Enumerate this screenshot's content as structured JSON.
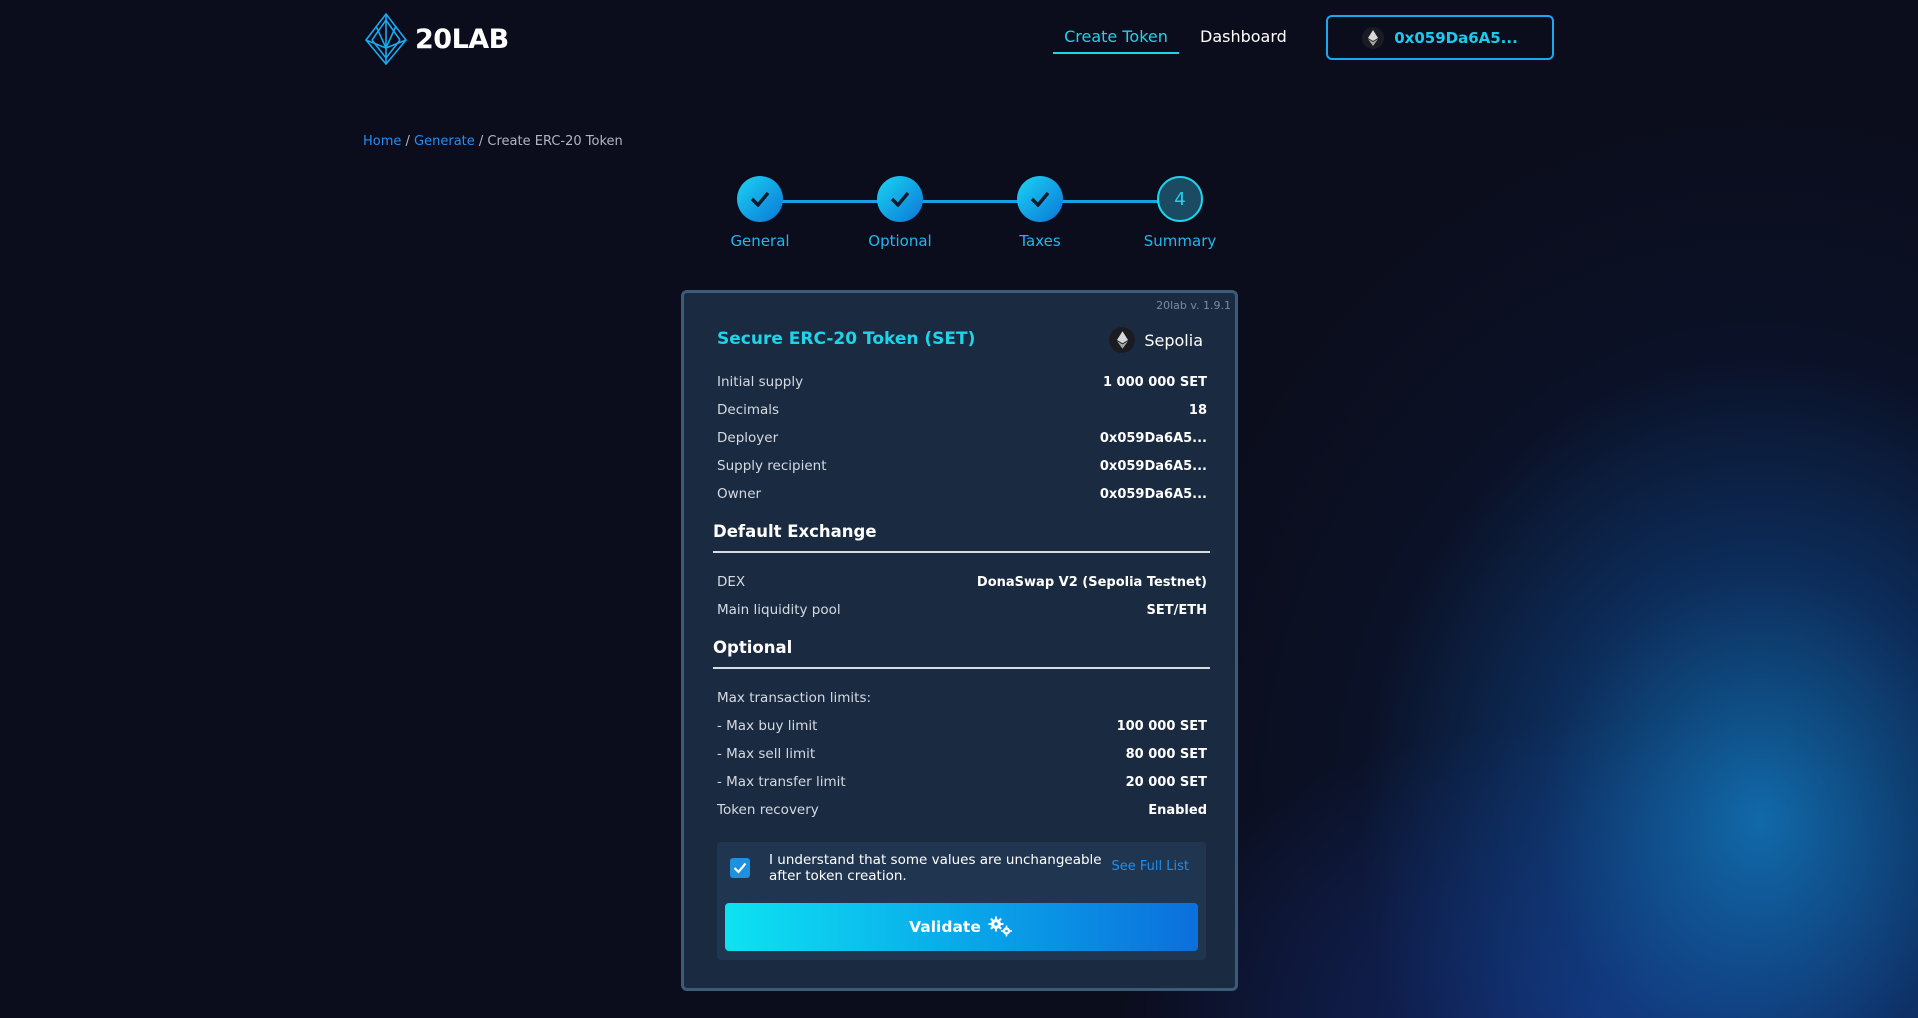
{
  "header": {
    "logo_text": "20LAB",
    "nav": {
      "create_token": "Create Token",
      "dashboard": "Dashboard"
    },
    "wallet_address": "0x059Da6A5..."
  },
  "breadcrumb": {
    "home": "Home",
    "sep1": " / ",
    "generate": "Generate",
    "sep2": " / ",
    "current": "Create ERC-20 Token"
  },
  "stepper": {
    "steps": [
      {
        "label": "General",
        "state": "done"
      },
      {
        "label": "Optional",
        "state": "done"
      },
      {
        "label": "Taxes",
        "state": "done"
      },
      {
        "label": "Summary",
        "state": "current",
        "number": "4"
      }
    ]
  },
  "summary": {
    "version": "20lab v. 1.9.1",
    "title": "Secure ERC-20 Token (SET)",
    "network": "Sepolia",
    "general_rows": [
      {
        "label": "Initial supply",
        "value": "1 000 000 SET"
      },
      {
        "label": "Decimals",
        "value": "18"
      },
      {
        "label": "Deployer",
        "value": "0x059Da6A5..."
      },
      {
        "label": "Supply recipient",
        "value": "0x059Da6A5..."
      },
      {
        "label": "Owner",
        "value": "0x059Da6A5..."
      }
    ],
    "exchange": {
      "heading": "Default Exchange",
      "rows": [
        {
          "label": "DEX",
          "value": "DonaSwap V2 (Sepolia Testnet)"
        },
        {
          "label": "Main liquidity pool",
          "value": "SET/ETH"
        }
      ]
    },
    "optional": {
      "heading": "Optional",
      "max_tx_label": "Max transaction limits:",
      "rows": [
        {
          "label": " - Max buy limit",
          "value": "100 000 SET"
        },
        {
          "label": " - Max sell limit",
          "value": "80 000 SET"
        },
        {
          "label": " - Max transfer limit",
          "value": "20 000 SET"
        },
        {
          "label": "Token recovery",
          "value": "Enabled"
        }
      ]
    },
    "confirm": {
      "checked": true,
      "text": "I understand that some values are unchangeable after token creation.",
      "see_full_list": "See Full List"
    },
    "validate_label": "Validate"
  },
  "colors": {
    "accent_cyan": "#1fd3e8",
    "accent_blue": "#1d90e0",
    "card_bg": "#1a2b41",
    "page_bg": "#0b0d1c"
  }
}
